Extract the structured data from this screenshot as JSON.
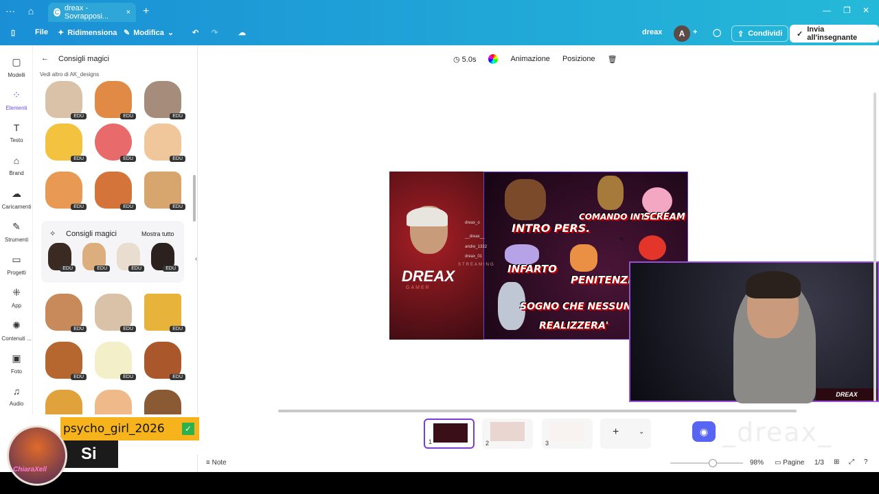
{
  "browser": {
    "tab_title": "dreax - Sovrapposi...",
    "new_tab": "+",
    "tab_close": "×",
    "min": "—",
    "max": "❐",
    "close": "✕"
  },
  "toolbar": {
    "file": "File",
    "resize": "Ridimensiona",
    "edit": "Modifica",
    "user": "dreax",
    "avatar_letter": "A",
    "share": "Condividi",
    "send": "Invia all'insegnante"
  },
  "rail": [
    {
      "label": "Modelli",
      "icon": "templates-icon"
    },
    {
      "label": "Elementi",
      "icon": "elements-icon"
    },
    {
      "label": "Testo",
      "icon": "text-icon"
    },
    {
      "label": "Brand",
      "icon": "brand-icon"
    },
    {
      "label": "Caricamenti",
      "icon": "upload-icon"
    },
    {
      "label": "Strumenti",
      "icon": "tools-icon"
    },
    {
      "label": "Progetti",
      "icon": "folder-icon"
    },
    {
      "label": "App",
      "icon": "apps-icon"
    },
    {
      "label": "Contenuti ...",
      "icon": "content-icon"
    },
    {
      "label": "Foto",
      "icon": "photo-icon"
    },
    {
      "label": "Audio",
      "icon": "audio-icon"
    }
  ],
  "panel": {
    "title": "Consigli magici",
    "byline": "Vedi altro di AK_designs",
    "magic_title": "Consigli magici",
    "show_all": "Mostra tutto",
    "edu": "EDU"
  },
  "context": {
    "duration": "5.0s",
    "animation": "Animazione",
    "position": "Posizione"
  },
  "design": {
    "brand": "DREAX",
    "sub": "GAMER",
    "streaming": "STREAMING",
    "socials": [
      "dreax_o",
      "__dreax__",
      "andre_1332",
      "dreax_01"
    ],
    "labels": [
      "INTRO PERS.",
      "COMANDO INTRO",
      "SCREAM",
      "INFARTO",
      "PENITENZE",
      "SOGNO CHE NESSUNO",
      "REALIZZERA'"
    ]
  },
  "webcam": {
    "tag": "DREAX"
  },
  "pages": {
    "items": [
      "1",
      "2",
      "3"
    ],
    "add": "+"
  },
  "discord": {
    "name": "_dreax_"
  },
  "bottom": {
    "notes": "Note",
    "zoom": "98%",
    "pages": "Pagine",
    "count": "1/3"
  },
  "stream": {
    "username": "psycho_girl_2026",
    "message": "Si",
    "ring_text": "ChiaraXell"
  }
}
